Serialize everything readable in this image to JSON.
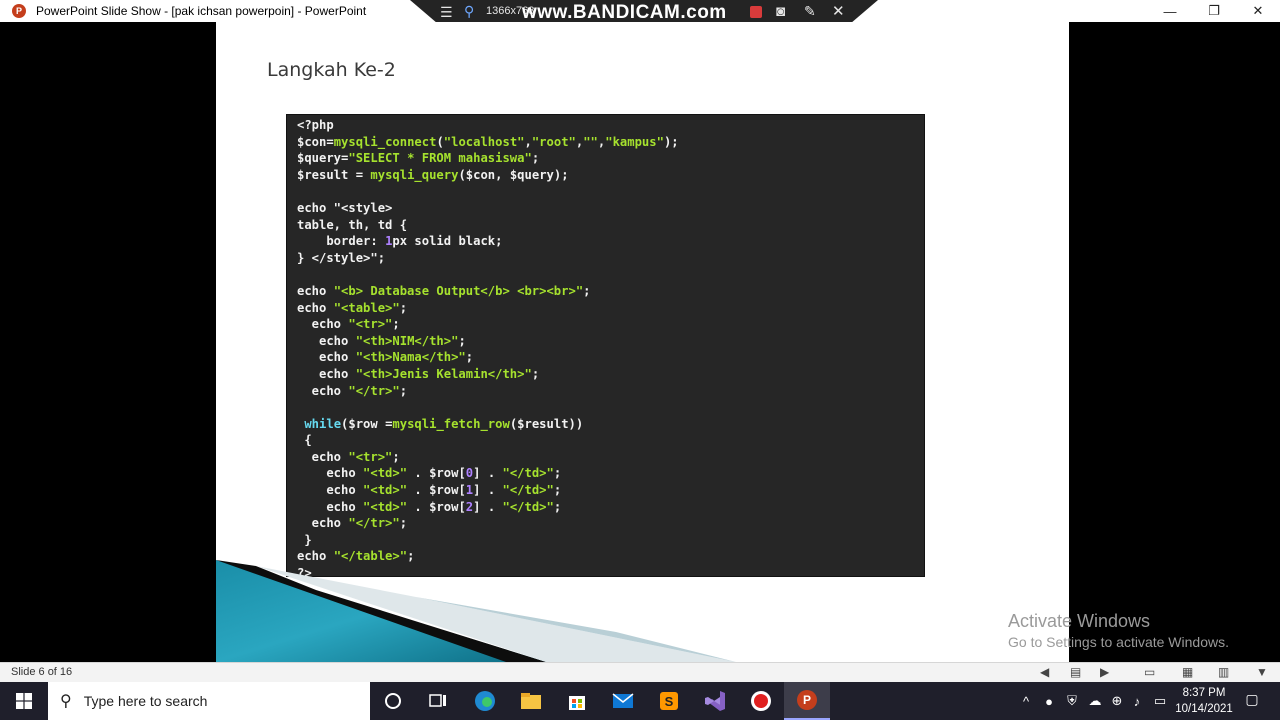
{
  "window": {
    "title": "PowerPoint Slide Show - [pak ichsan powerpoin] - PowerPoint",
    "app_icon_letter": "P",
    "minimize": "—",
    "restore": "❐",
    "close": "✕"
  },
  "recorder": {
    "resolution": "1366x768",
    "watermark": "www.BANDICAM.com"
  },
  "slide": {
    "title": "Langkah Ke-2",
    "code": [
      [
        [
          "kw",
          "<?php"
        ]
      ],
      [
        [
          "var",
          "$con"
        ],
        [
          "kw",
          "="
        ],
        [
          "fn",
          "mysqli_connect"
        ],
        [
          "kw",
          "("
        ],
        [
          "str",
          "\"localhost\""
        ],
        [
          "kw",
          ","
        ],
        [
          "str",
          "\"root\""
        ],
        [
          "kw",
          ","
        ],
        [
          "str",
          "\"\""
        ],
        [
          "kw",
          ","
        ],
        [
          "str",
          "\"kampus\""
        ],
        [
          "kw",
          ");"
        ]
      ],
      [
        [
          "var",
          "$query"
        ],
        [
          "kw",
          "="
        ],
        [
          "str",
          "\"SELECT * FROM mahasiswa\""
        ],
        [
          "kw",
          ";"
        ]
      ],
      [
        [
          "var",
          "$result"
        ],
        [
          "kw",
          " = "
        ],
        [
          "fn",
          "mysqli_query"
        ],
        [
          "kw",
          "("
        ],
        [
          "var",
          "$con"
        ],
        [
          "kw",
          ", "
        ],
        [
          "var",
          "$query"
        ],
        [
          "kw",
          ");"
        ]
      ],
      [
        [
          "kw",
          " "
        ]
      ],
      [
        [
          "kw",
          "echo \"<style>"
        ]
      ],
      [
        [
          "kw",
          "table, th, td {"
        ]
      ],
      [
        [
          "kw",
          "    border: "
        ],
        [
          "num",
          "1"
        ],
        [
          "kw",
          "px solid black;"
        ]
      ],
      [
        [
          "kw",
          "} </style>\";"
        ]
      ],
      [
        [
          "kw",
          " "
        ]
      ],
      [
        [
          "kw",
          "echo "
        ],
        [
          "str",
          "\"<b> Database Output</b> <br><br>\""
        ],
        [
          "kw",
          ";"
        ]
      ],
      [
        [
          "kw",
          "echo "
        ],
        [
          "str",
          "\"<table>\""
        ],
        [
          "kw",
          ";"
        ]
      ],
      [
        [
          "kw",
          "  echo "
        ],
        [
          "str",
          "\"<tr>\""
        ],
        [
          "kw",
          ";"
        ]
      ],
      [
        [
          "kw",
          "   echo "
        ],
        [
          "str",
          "\"<th>NIM</th>\""
        ],
        [
          "kw",
          ";"
        ]
      ],
      [
        [
          "kw",
          "   echo "
        ],
        [
          "str",
          "\"<th>Nama</th>\""
        ],
        [
          "kw",
          ";"
        ]
      ],
      [
        [
          "kw",
          "   echo "
        ],
        [
          "str",
          "\"<th>Jenis Kelamin</th>\""
        ],
        [
          "kw",
          ";"
        ]
      ],
      [
        [
          "kw",
          "  echo "
        ],
        [
          "str",
          "\"</tr>\""
        ],
        [
          "kw",
          ";"
        ]
      ],
      [
        [
          "kw",
          " "
        ]
      ],
      [
        [
          "kw",
          " "
        ],
        [
          "blue",
          "while"
        ],
        [
          "kw",
          "("
        ],
        [
          "var",
          "$row"
        ],
        [
          "kw",
          " ="
        ],
        [
          "fn",
          "mysqli_fetch_row"
        ],
        [
          "kw",
          "("
        ],
        [
          "var",
          "$result"
        ],
        [
          "kw",
          "))"
        ]
      ],
      [
        [
          "kw",
          " {"
        ]
      ],
      [
        [
          "kw",
          "  echo "
        ],
        [
          "str",
          "\"<tr>\""
        ],
        [
          "kw",
          ";"
        ]
      ],
      [
        [
          "kw",
          "    echo "
        ],
        [
          "str",
          "\"<td>\""
        ],
        [
          "kw",
          " . "
        ],
        [
          "var",
          "$row"
        ],
        [
          "kw",
          "["
        ],
        [
          "num",
          "0"
        ],
        [
          "kw",
          "] . "
        ],
        [
          "str",
          "\"</td>\""
        ],
        [
          "kw",
          ";"
        ]
      ],
      [
        [
          "kw",
          "    echo "
        ],
        [
          "str",
          "\"<td>\""
        ],
        [
          "kw",
          " . "
        ],
        [
          "var",
          "$row"
        ],
        [
          "kw",
          "["
        ],
        [
          "num",
          "1"
        ],
        [
          "kw",
          "] . "
        ],
        [
          "str",
          "\"</td>\""
        ],
        [
          "kw",
          ";"
        ]
      ],
      [
        [
          "kw",
          "    echo "
        ],
        [
          "str",
          "\"<td>\""
        ],
        [
          "kw",
          " . "
        ],
        [
          "var",
          "$row"
        ],
        [
          "kw",
          "["
        ],
        [
          "num",
          "2"
        ],
        [
          "kw",
          "] . "
        ],
        [
          "str",
          "\"</td>\""
        ],
        [
          "kw",
          ";"
        ]
      ],
      [
        [
          "kw",
          "  echo "
        ],
        [
          "str",
          "\"</tr>\""
        ],
        [
          "kw",
          ";"
        ]
      ],
      [
        [
          "kw",
          " }"
        ]
      ],
      [
        [
          "kw",
          "echo "
        ],
        [
          "str",
          "\"</table>\""
        ],
        [
          "kw",
          ";"
        ]
      ],
      [
        [
          "kw",
          "?>"
        ]
      ]
    ]
  },
  "activation": {
    "line1": "Activate Windows",
    "line2": "Go to Settings to activate Windows."
  },
  "statusbar": {
    "slide_count": "Slide 6 of 16"
  },
  "taskbar": {
    "search_placeholder": "Type here to search",
    "time": "8:37 PM",
    "date": "10/14/2021"
  },
  "colors": {
    "code_bg": "#262626",
    "code_string": "#a6e22e",
    "code_number": "#ae81ff",
    "code_keyword_blue": "#66d9ef",
    "taskbar_bg": "#1f1f2b",
    "powerpoint_orange": "#c43e1c"
  }
}
